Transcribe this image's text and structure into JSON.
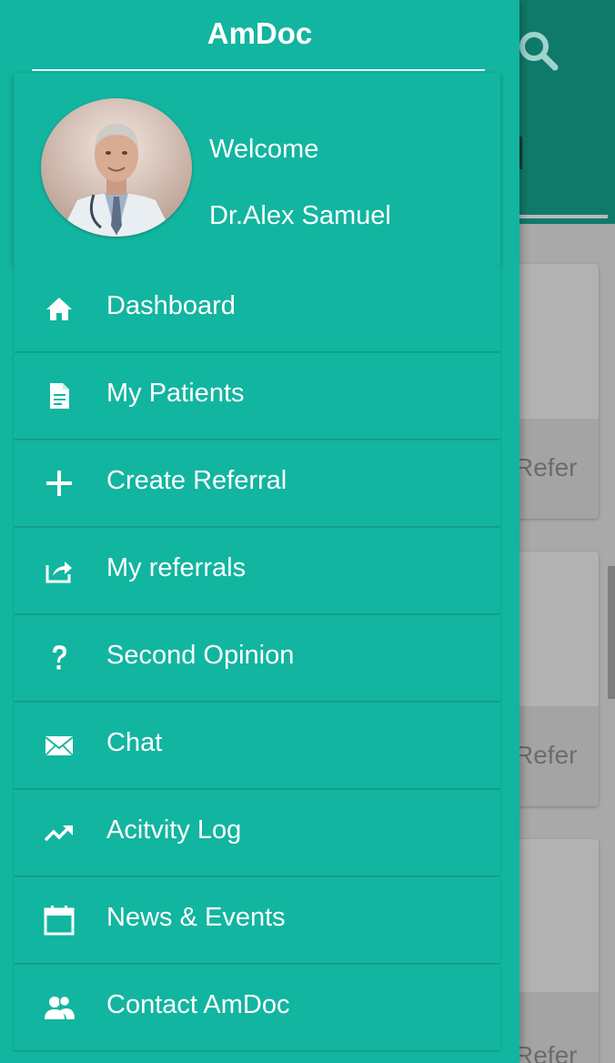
{
  "drawer": {
    "title": "AmDoc",
    "profile": {
      "welcome": "Welcome",
      "name": "Dr.Alex Samuel"
    },
    "menu": [
      {
        "label": "Dashboard",
        "icon": "home-icon"
      },
      {
        "label": "My Patients",
        "icon": "document-icon"
      },
      {
        "label": "Create Referral",
        "icon": "plus-icon"
      },
      {
        "label": "My referrals",
        "icon": "share-icon"
      },
      {
        "label": "Second Opinion",
        "icon": "question-icon"
      },
      {
        "label": "Chat",
        "icon": "mail-icon"
      },
      {
        "label": "Acitvity Log",
        "icon": "trending-up-icon"
      },
      {
        "label": "News & Events",
        "icon": "calendar-icon"
      },
      {
        "label": "Contact AmDoc",
        "icon": "people-icon"
      }
    ]
  },
  "background": {
    "card_label": "Refer"
  },
  "colors": {
    "drawer": "#12b5a0",
    "header": "#0f7a6a",
    "scrim_background": "#a9a9a9",
    "text": "#ffffff"
  }
}
